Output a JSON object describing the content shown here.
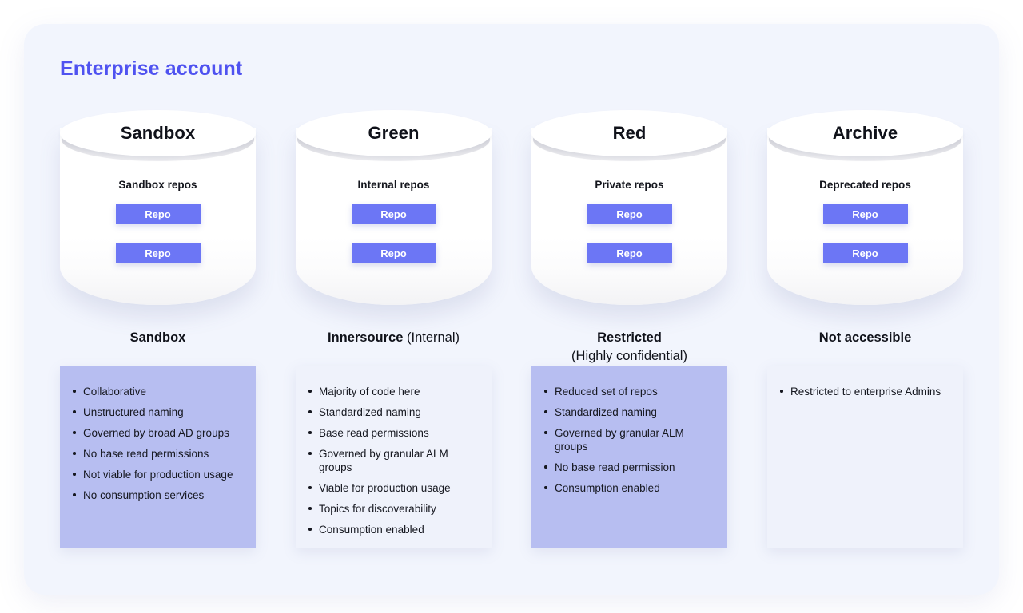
{
  "panel": {
    "title": "Enterprise account"
  },
  "columns": [
    {
      "cylinder_title": "Sandbox",
      "repo_group_label": "Sandbox repos",
      "repo_chips": [
        "Repo",
        "Repo"
      ],
      "caption_strong": "Sandbox",
      "caption_normal": "",
      "card_style": "accent",
      "bullets": [
        "Collaborative",
        "Unstructured naming",
        "Governed by broad AD groups",
        "No base read permissions",
        "Not viable for production usage",
        "No consumption services"
      ]
    },
    {
      "cylinder_title": "Green",
      "repo_group_label": "Internal repos",
      "repo_chips": [
        "Repo",
        "Repo"
      ],
      "caption_strong": "Innersource",
      "caption_normal": "(Internal)",
      "card_style": "plain",
      "bullets": [
        "Majority of code here",
        "Standardized naming",
        "Base read permissions",
        "Governed by granular ALM groups",
        "Viable for production usage",
        "Topics for discoverability",
        "Consumption enabled"
      ]
    },
    {
      "cylinder_title": "Red",
      "repo_group_label": "Private repos",
      "repo_chips": [
        "Repo",
        "Repo"
      ],
      "caption_strong": "Restricted",
      "caption_normal": "(Highly confidential)",
      "card_style": "accent",
      "bullets": [
        "Reduced set of repos",
        "Standardized naming",
        "Governed by granular ALM groups",
        "No base read permission",
        "Consumption enabled"
      ]
    },
    {
      "cylinder_title": "Archive",
      "repo_group_label": "Deprecated repos",
      "repo_chips": [
        "Repo",
        "Repo"
      ],
      "caption_strong": "Not accessible",
      "caption_normal": "",
      "card_style": "plain",
      "bullets": [
        "Restricted to enterprise Admins"
      ]
    }
  ],
  "colors": {
    "page_background": "#ffffff",
    "panel_background": "#f2f5fd",
    "title_accent": "#4f52f0",
    "repo_chip": "#6c76f5",
    "card_accent": "#b7bef1",
    "card_plain": "#eff2fb",
    "text_primary": "#10121a"
  }
}
